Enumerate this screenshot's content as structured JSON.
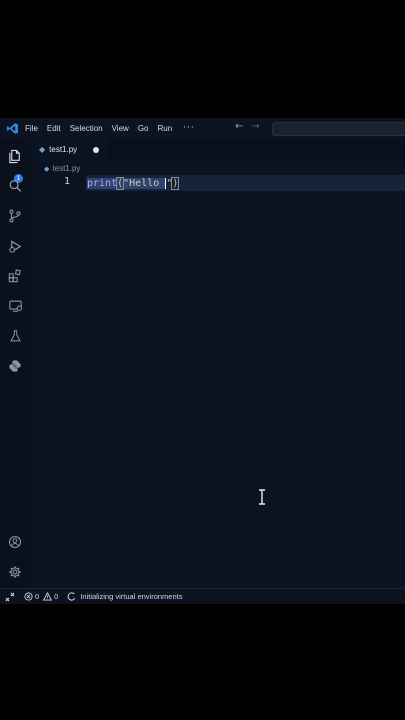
{
  "menu": {
    "items": [
      "File",
      "Edit",
      "Selection",
      "View",
      "Go",
      "Run"
    ],
    "more": "···"
  },
  "tab": {
    "label": "test1.py",
    "modified": true
  },
  "breadcrumb": {
    "file": "test1.py"
  },
  "editor": {
    "line_number": "1",
    "code": {
      "fn": "print",
      "open": "(",
      "string": "\"Hello ",
      "close_quote": "\"",
      "close": ")"
    }
  },
  "activity": {
    "explorer_badge": "1"
  },
  "status": {
    "errors": "0",
    "warnings": "0",
    "message": "Initializing virtual environments"
  },
  "colors": {
    "accent": "#2f7de1",
    "background": "#0b1220"
  }
}
